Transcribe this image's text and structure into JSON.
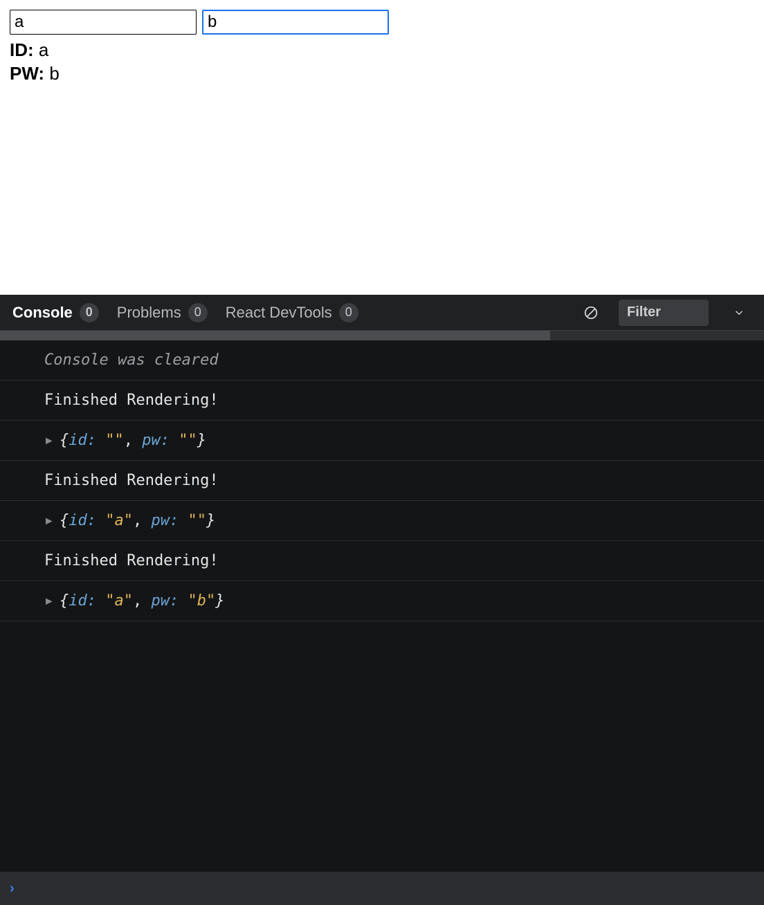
{
  "form": {
    "id_value": "a",
    "pw_value": "b",
    "readout": {
      "id_label": "ID:",
      "pw_label": "PW:",
      "id_value": "a",
      "pw_value": "b"
    }
  },
  "devtools": {
    "tabs": [
      {
        "label": "Console",
        "count": "0",
        "active": true
      },
      {
        "label": "Problems",
        "count": "0",
        "active": false
      },
      {
        "label": "React DevTools",
        "count": "0",
        "active": false
      }
    ],
    "filter_placeholder": "Filter",
    "logs": [
      {
        "kind": "info",
        "text": "Console was cleared"
      },
      {
        "kind": "plain",
        "text": "Finished Rendering!"
      },
      {
        "kind": "object",
        "entries": [
          {
            "key": "id",
            "value": "\"\""
          },
          {
            "key": "pw",
            "value": "\"\""
          }
        ]
      },
      {
        "kind": "plain",
        "text": "Finished Rendering!"
      },
      {
        "kind": "object",
        "entries": [
          {
            "key": "id",
            "value": "\"a\""
          },
          {
            "key": "pw",
            "value": "\"\""
          }
        ]
      },
      {
        "kind": "plain",
        "text": "Finished Rendering!"
      },
      {
        "kind": "object",
        "entries": [
          {
            "key": "id",
            "value": "\"a\""
          },
          {
            "key": "pw",
            "value": "\"b\""
          }
        ]
      }
    ],
    "prompt_symbol": "›"
  }
}
